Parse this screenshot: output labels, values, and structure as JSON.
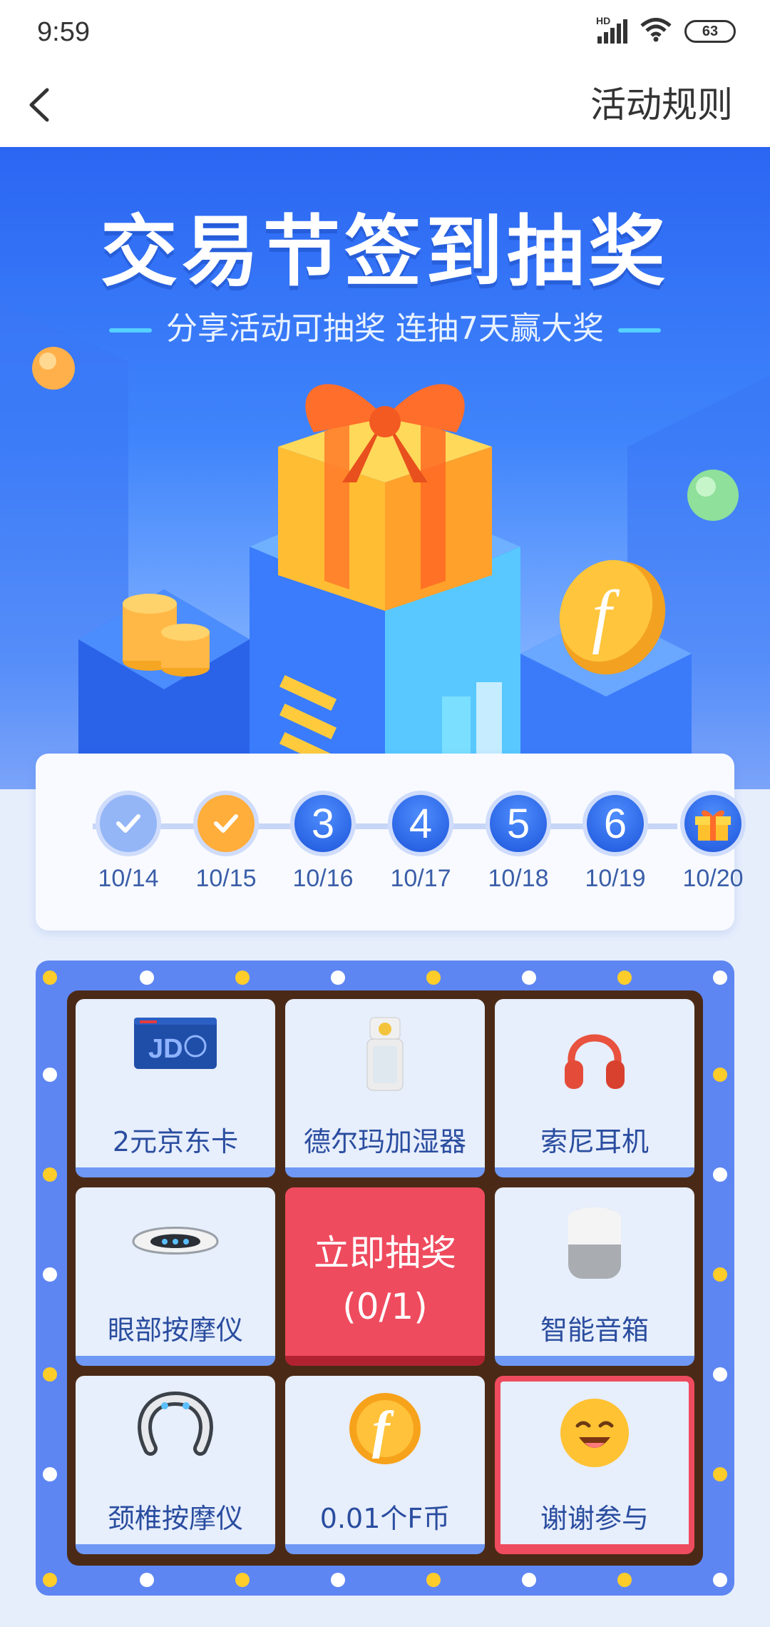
{
  "status_bar": {
    "time": "9:59",
    "network": "HD",
    "battery": "63",
    "icons": [
      "signal-icon",
      "wifi-icon",
      "battery-icon"
    ]
  },
  "nav": {
    "back_icon": "chevron-left-icon",
    "rules_label": "活动规则"
  },
  "banner": {
    "title": "交易节签到抽奖",
    "subtitle": "分享活动可抽奖 连抽7天赢大奖"
  },
  "checkin": {
    "days": [
      {
        "label": "",
        "date": "10/14",
        "state": "done"
      },
      {
        "label": "",
        "date": "10/15",
        "state": "today"
      },
      {
        "label": "3",
        "date": "10/16",
        "state": "upcoming"
      },
      {
        "label": "4",
        "date": "10/17",
        "state": "upcoming"
      },
      {
        "label": "5",
        "date": "10/18",
        "state": "upcoming"
      },
      {
        "label": "6",
        "date": "10/19",
        "state": "upcoming"
      },
      {
        "label": "",
        "date": "10/20",
        "state": "gift"
      }
    ]
  },
  "lottery": {
    "prizes": [
      {
        "label": "2元京东卡",
        "icon": "jd-card-icon"
      },
      {
        "label": "德尔玛加湿器",
        "icon": "humidifier-icon"
      },
      {
        "label": "索尼耳机",
        "icon": "headphones-icon"
      },
      {
        "label": "眼部按摩仪",
        "icon": "eye-massager-icon"
      },
      {
        "label": "智能音箱",
        "icon": "smart-speaker-icon"
      },
      {
        "label": "颈椎按摩仪",
        "icon": "neck-massager-icon"
      },
      {
        "label": "0.01个F币",
        "icon": "f-coin-icon"
      },
      {
        "label": "谢谢参与",
        "icon": "smile-icon"
      }
    ],
    "draw_button": {
      "label": "立即抽奖",
      "count": "(0/1)"
    }
  },
  "colors": {
    "primary_blue": "#2b66f2",
    "accent_red": "#ef4b5e",
    "accent_orange": "#ffad3b",
    "board_blue": "#5e86f2"
  }
}
